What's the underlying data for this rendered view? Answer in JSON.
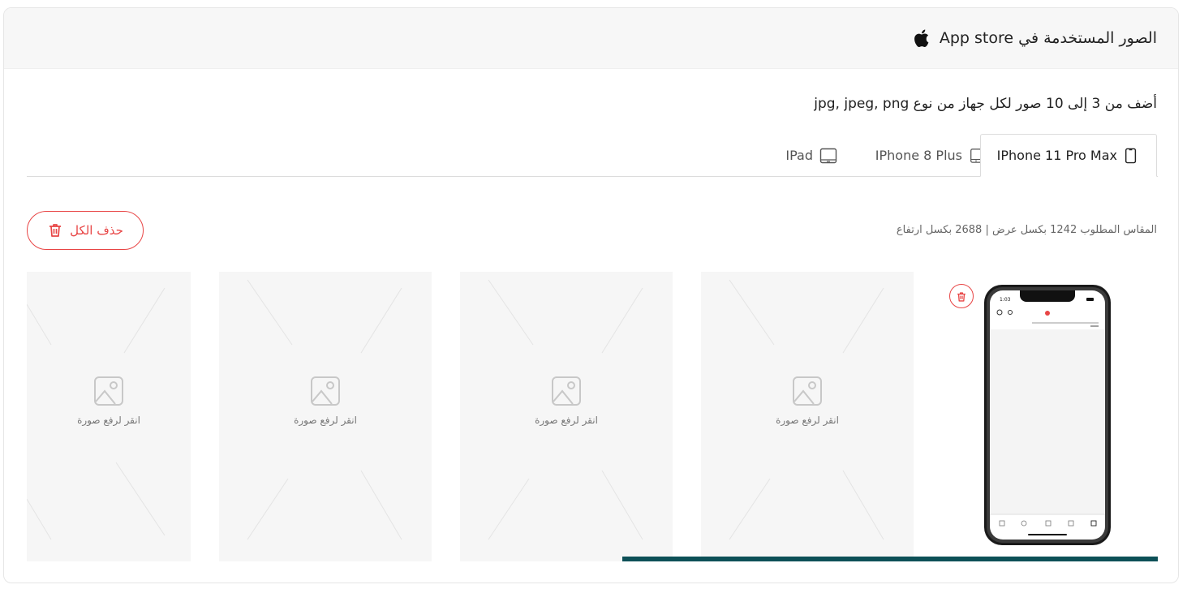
{
  "header": {
    "title": "الصور المستخدمة في App store",
    "icon": "apple-icon"
  },
  "instructions": "أضف من 3 إلى 10 صور لكل جهاز من نوع jpg, jpeg, png",
  "tabs": [
    {
      "label": "IPhone 11 Pro Max",
      "icon": "phone-icon",
      "active": true
    },
    {
      "label": "IPhone 8 Plus",
      "icon": "phone-home-button-icon",
      "active": false
    },
    {
      "label": "IPad",
      "icon": "tablet-icon",
      "active": false
    }
  ],
  "size_info": "المقاس المطلوب 1242 بكسل عرض | 2688 بكسل ارتفاع",
  "delete_all_label": "حذف الكل",
  "upload_slots": [
    {
      "label": "انقر لرفع صورة"
    },
    {
      "label": "انقر لرفع صورة"
    },
    {
      "label": "انقر لرفع صورة"
    },
    {
      "label": "انقر لرفع صورة"
    }
  ],
  "uploaded_preview": {
    "status_time": "1:03"
  },
  "colors": {
    "accent_red": "#e84545",
    "progress_teal": "#0d5057",
    "header_bg": "#f7f7f7"
  }
}
